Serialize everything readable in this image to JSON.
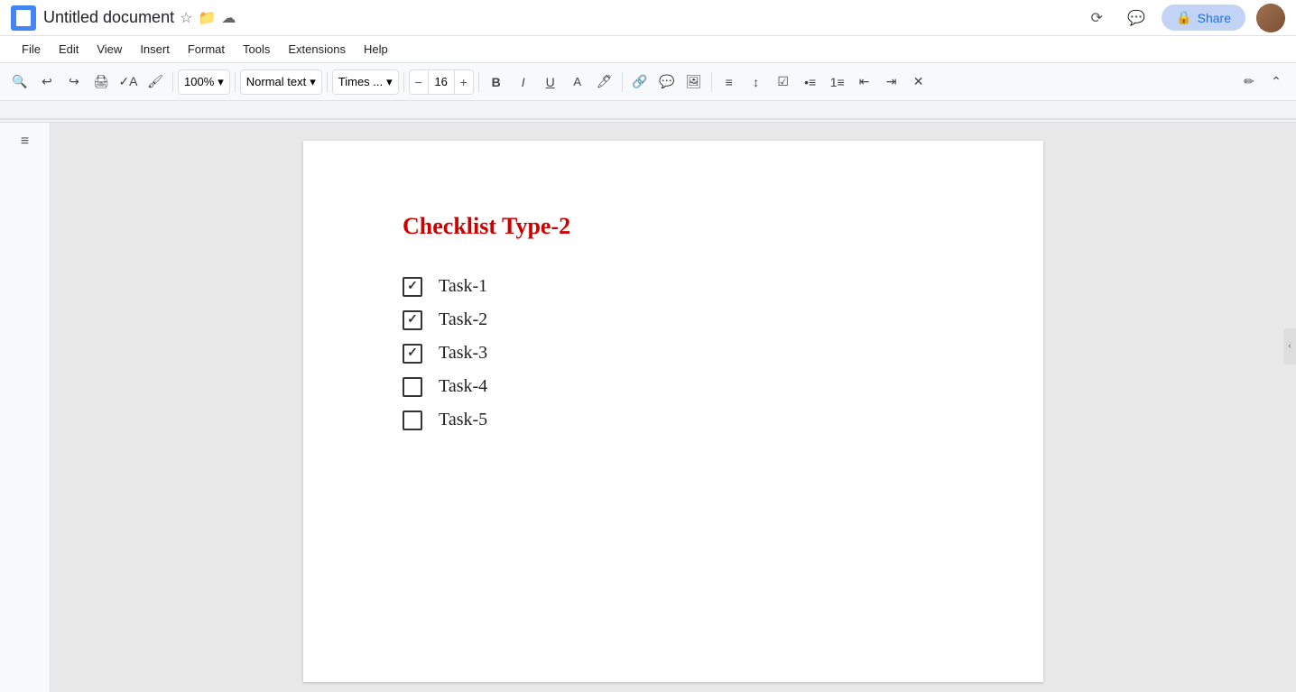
{
  "titleBar": {
    "docTitle": "Untitled document",
    "starIcon": "☆",
    "historyIcon": "⟳",
    "commentIcon": "💬",
    "shareLabel": "Share",
    "lockIcon": "🔒"
  },
  "menuBar": {
    "items": [
      "File",
      "Edit",
      "View",
      "Insert",
      "Format",
      "Tools",
      "Extensions",
      "Help"
    ]
  },
  "toolbar": {
    "zoomLevel": "100%",
    "textStyle": "Normal text",
    "fontFamily": "Times ...",
    "fontSize": "16",
    "buttons": {
      "bold": "B",
      "italic": "I",
      "underline": "U",
      "minus": "−",
      "plus": "+"
    }
  },
  "document": {
    "title": "Checklist Type-2",
    "tasks": [
      {
        "label": "Task-1",
        "checked": true
      },
      {
        "label": "Task-2",
        "checked": true
      },
      {
        "label": "Task-3",
        "checked": true
      },
      {
        "label": "Task-4",
        "checked": false
      },
      {
        "label": "Task-5",
        "checked": false
      }
    ]
  },
  "sidebar": {
    "outlineIcon": "≡"
  }
}
